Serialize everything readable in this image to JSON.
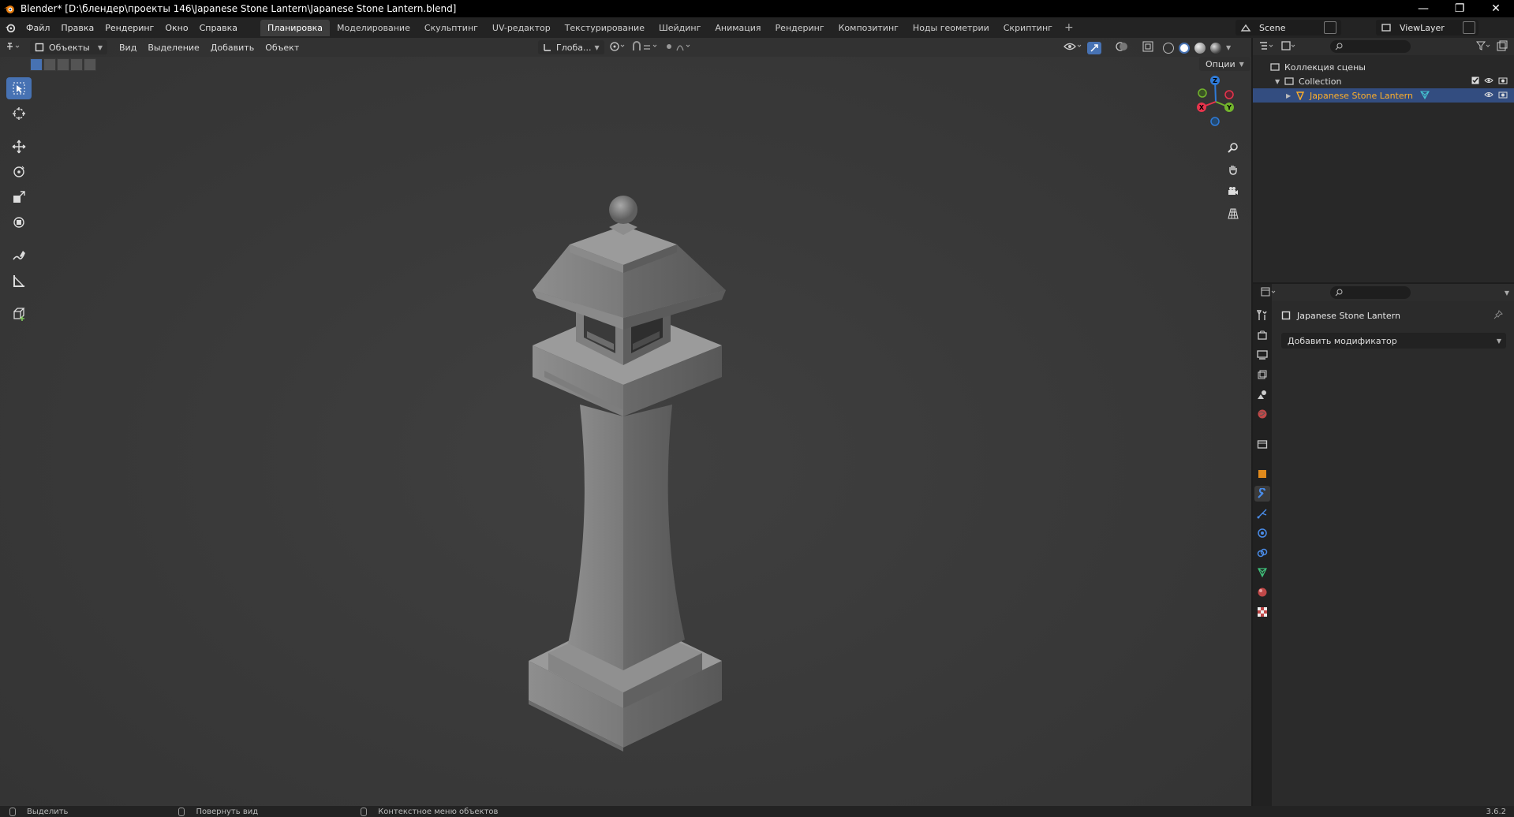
{
  "window": {
    "title": "Blender* [D:\\блендер\\проекты 146\\Japanese Stone Lantern\\Japanese Stone Lantern.blend]",
    "minimize": "—",
    "restore": "❐",
    "close": "✕"
  },
  "menu": [
    "Файл",
    "Правка",
    "Рендеринг",
    "Окно",
    "Справка"
  ],
  "workspaces": [
    "Планировка",
    "Моделирование",
    "Скульптинг",
    "UV-редактор",
    "Текстурирование",
    "Шейдинг",
    "Анимация",
    "Рендеринг",
    "Композитинг",
    "Ноды геометрии",
    "Скриптинг"
  ],
  "workspace_add": "+",
  "scene": "Scene",
  "view_layer": "ViewLayer",
  "viewport": {
    "mode": "Объекты",
    "menus": [
      "Вид",
      "Выделение",
      "Добавить",
      "Объект"
    ],
    "orientation": "Глоба...",
    "options": "Опции",
    "gizmo": {
      "z": "Z",
      "y": "Y",
      "x": "X"
    }
  },
  "outliner": {
    "scene_collection": "Коллекция сцены",
    "collection": "Collection",
    "object": "Japanese Stone Lantern"
  },
  "properties": {
    "object_name": "Japanese Stone Lantern",
    "add_modifier": "Добавить модификатор"
  },
  "statusbar": {
    "select": "Выделить",
    "rotate": "Повернуть вид",
    "context": "Контекстное меню объектов",
    "version": "3.6.2"
  },
  "colors": {
    "accent": "#4772b3",
    "selected_text": "#ffaf29",
    "axis_x": "#e8344c",
    "axis_y": "#72b42c",
    "axis_z": "#2f7bd8"
  }
}
